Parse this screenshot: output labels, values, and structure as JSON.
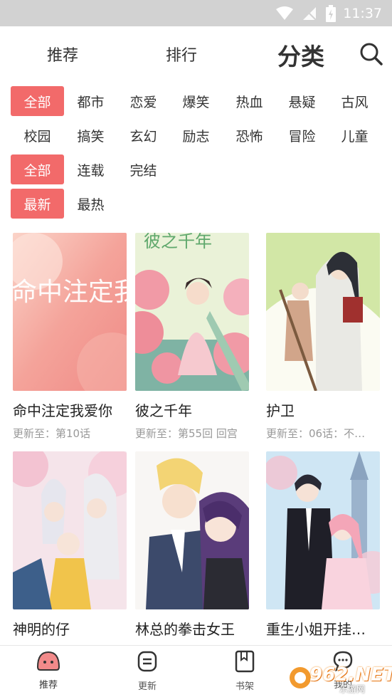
{
  "status_bar": {
    "time": "11:37"
  },
  "top_nav": {
    "tabs": [
      {
        "label": "推荐"
      },
      {
        "label": "排行"
      },
      {
        "label": "分类"
      }
    ]
  },
  "filters": {
    "genres_row1": [
      "全部",
      "都市",
      "恋爱",
      "爆笑",
      "热血",
      "悬疑",
      "古风"
    ],
    "genres_row2": [
      "校园",
      "搞笑",
      "玄幻",
      "励志",
      "恐怖",
      "冒险",
      "儿童"
    ],
    "status": [
      "全部",
      "连载",
      "完结"
    ],
    "sort": [
      "最新",
      "最热"
    ]
  },
  "comics": [
    {
      "title": "命中注定我爱你",
      "update": "更新至：第10话",
      "cover_text": "命中注定我爱你"
    },
    {
      "title": "彼之千年",
      "update": "更新至：第55回 回宫",
      "cover_text": "彼之千年"
    },
    {
      "title": "护卫",
      "update": "更新至：06话：不…"
    },
    {
      "title": "神明的仔",
      "update": ""
    },
    {
      "title": "林总的拳击女王",
      "update": ""
    },
    {
      "title": "重生小姐开挂…",
      "update": ""
    }
  ],
  "bottom_nav": {
    "items": [
      {
        "label": "推荐",
        "icon": "home-face-icon"
      },
      {
        "label": "更新",
        "icon": "update-list-icon"
      },
      {
        "label": "书架",
        "icon": "bookshelf-icon"
      },
      {
        "label": "我的",
        "icon": "profile-chat-icon"
      }
    ]
  },
  "watermark": {
    "text": "962.NET",
    "sub": "乐游网"
  },
  "colors": {
    "accent": "#f26a6a",
    "status_bar": "#d2d2d2"
  }
}
